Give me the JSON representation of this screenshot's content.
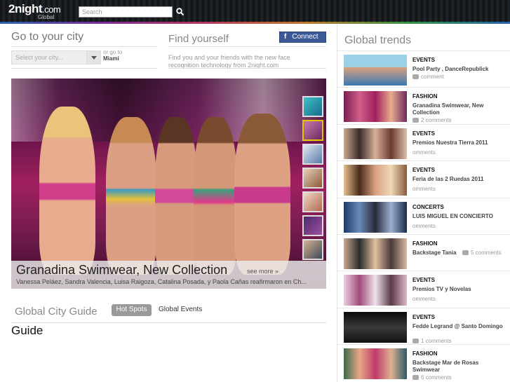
{
  "header": {
    "logo_main": "2night",
    "logo_dotcom": ".com",
    "logo_sub": "Global",
    "search_placeholder": "Search"
  },
  "city": {
    "heading": "Go to your city",
    "select_placeholder": "Select your city...",
    "or_goto": "or go to",
    "miami": "Miami"
  },
  "find": {
    "heading": "Find yourself",
    "connect_label": "Connect",
    "fb_glyph": "f",
    "description": "Find you and your friends with the new face recognition technology from 2night.com"
  },
  "hero": {
    "title": "Granadina Swimwear, New Collection",
    "more": "see more »",
    "description": "Vanessa Peláez, Sandra Valencia, Luisa Raigoza, Catalina Posada, y Paola Cañas reafirmaron en Ch..."
  },
  "guide": {
    "heading": "Global City Guide",
    "tab_hot_spots": "Hot Spots",
    "tab_global_events": "Global Events",
    "title": "Guide"
  },
  "trends": {
    "heading": "Global trends",
    "items": [
      {
        "category": "EVENTS",
        "title": "Pool Party , DanceRepublick",
        "comments": "comment"
      },
      {
        "category": "FASHION",
        "title": "Granadina Swimwear, New Collection",
        "comments": "2 comments"
      },
      {
        "category": "EVENTS",
        "title": "Premios Nuestra Tierra 2011",
        "comments": "omments"
      },
      {
        "category": "EVENTS",
        "title": "Feria de las 2 Ruedas 2011",
        "comments": "omments"
      },
      {
        "category": "CONCERTS",
        "title": "LUIS MIGUEL EN CONCIERTO",
        "comments": "omments"
      },
      {
        "category": "FASHION",
        "title": "Backstage Tania",
        "comments": "5 comments"
      },
      {
        "category": "EVENTS",
        "title": "Premios TV y Novelas",
        "comments": "omments"
      },
      {
        "category": "EVENTS",
        "title": "Fedde Legrand @ Santo Domingo",
        "comments": "1 comments"
      },
      {
        "category": "FASHION",
        "title": "Backstage Mar de Rosas Swimwear",
        "comments": "6 comments"
      }
    ]
  }
}
